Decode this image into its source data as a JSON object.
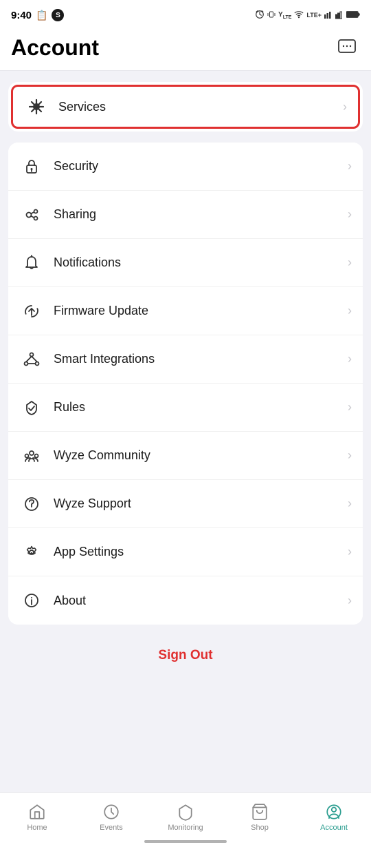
{
  "statusBar": {
    "time": "9:40",
    "icons": [
      "clipboard",
      "shazam",
      "alarm",
      "vibrate",
      "signal-bars",
      "wifi-lte",
      "signal-1",
      "signal-2",
      "battery"
    ]
  },
  "header": {
    "title": "Account",
    "chatIconLabel": "chat-icon"
  },
  "menuItems": [
    {
      "id": "services",
      "label": "Services",
      "icon": "services-icon",
      "highlighted": true
    },
    {
      "id": "security",
      "label": "Security",
      "icon": "security-icon",
      "highlighted": false
    },
    {
      "id": "sharing",
      "label": "Sharing",
      "icon": "sharing-icon",
      "highlighted": false
    },
    {
      "id": "notifications",
      "label": "Notifications",
      "icon": "notifications-icon",
      "highlighted": false
    },
    {
      "id": "firmware-update",
      "label": "Firmware Update",
      "icon": "firmware-icon",
      "highlighted": false
    },
    {
      "id": "smart-integrations",
      "label": "Smart Integrations",
      "icon": "integrations-icon",
      "highlighted": false
    },
    {
      "id": "rules",
      "label": "Rules",
      "icon": "rules-icon",
      "highlighted": false
    },
    {
      "id": "wyze-community",
      "label": "Wyze Community",
      "icon": "community-icon",
      "highlighted": false
    },
    {
      "id": "wyze-support",
      "label": "Wyze Support",
      "icon": "support-icon",
      "highlighted": false
    },
    {
      "id": "app-settings",
      "label": "App Settings",
      "icon": "settings-icon",
      "highlighted": false
    },
    {
      "id": "about",
      "label": "About",
      "icon": "about-icon",
      "highlighted": false
    }
  ],
  "signOut": {
    "label": "Sign Out"
  },
  "bottomNav": {
    "items": [
      {
        "id": "home",
        "label": "Home",
        "active": false
      },
      {
        "id": "events",
        "label": "Events",
        "active": false
      },
      {
        "id": "monitoring",
        "label": "Monitoring",
        "active": false
      },
      {
        "id": "shop",
        "label": "Shop",
        "active": false
      },
      {
        "id": "account",
        "label": "Account",
        "active": true
      }
    ]
  }
}
